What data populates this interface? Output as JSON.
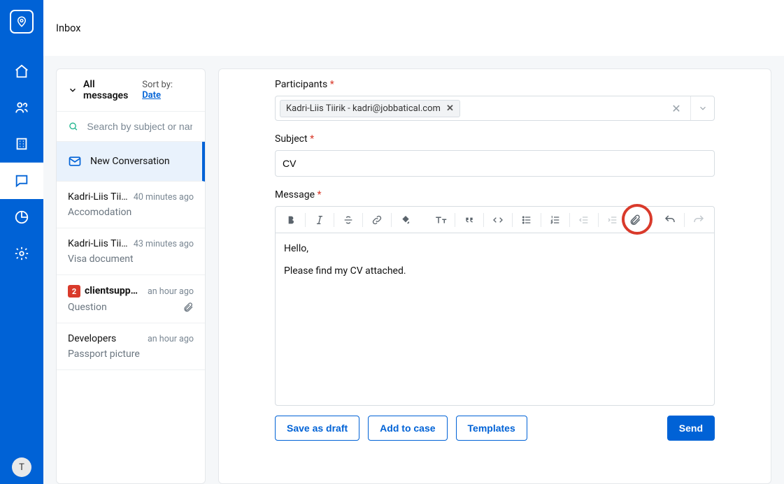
{
  "brand_color": "#0062D6",
  "header": {
    "title": "Inbox"
  },
  "sidebar": {
    "avatar_initial": "T"
  },
  "inbox": {
    "filter_label": "All messages",
    "sort_prefix": "Sort by: ",
    "sort_value": "Date",
    "search_placeholder": "Search by subject or name",
    "new_conversation_label": "New Conversation",
    "conversations": [
      {
        "title": "Kadri-Liis Tiirik",
        "time": "40 minutes ago",
        "subject": "Accomodation",
        "unread": 0,
        "has_attachment": false
      },
      {
        "title": "Kadri-Liis Tiirik, kadri germany",
        "time": "43 minutes ago",
        "subject": "Visa document",
        "unread": 0,
        "has_attachment": false
      },
      {
        "title": "clientsupport@jobbatical.com,",
        "time": "an hour ago",
        "subject": "Question",
        "unread": 2,
        "has_attachment": true
      },
      {
        "title": "Developers",
        "time": "an hour ago",
        "subject": "Passport picture",
        "unread": 0,
        "has_attachment": false
      }
    ]
  },
  "compose": {
    "participants_label": "Participants",
    "subject_label": "Subject",
    "message_label": "Message",
    "required_mark": "*",
    "chip_text": "Kadri-Liis Tiirik - kadri@jobbatical.com",
    "subject_value": "CV",
    "body_line1": "Hello,",
    "body_line2": "Please find my CV attached.",
    "buttons": {
      "save_draft": "Save as draft",
      "add_to_case": "Add to case",
      "templates": "Templates",
      "send": "Send"
    }
  }
}
